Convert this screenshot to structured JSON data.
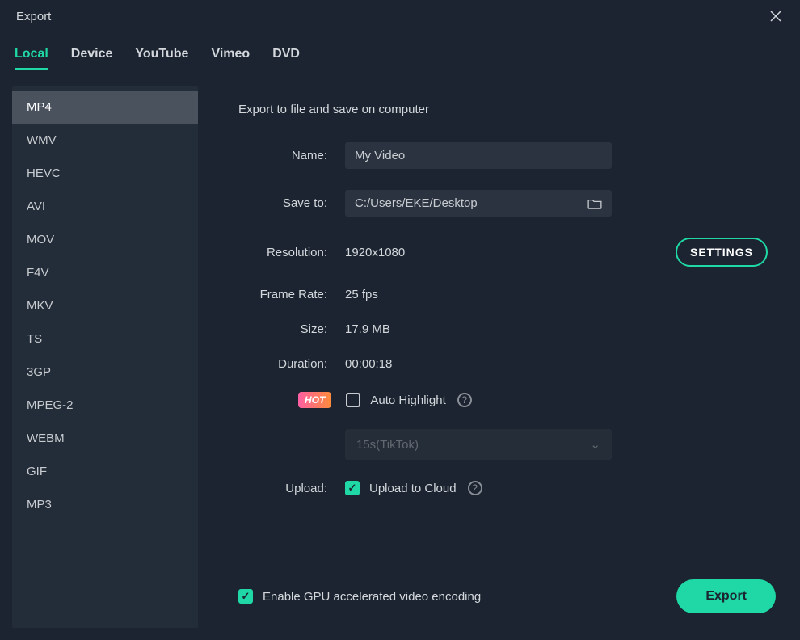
{
  "title": "Export",
  "tabs": [
    "Local",
    "Device",
    "YouTube",
    "Vimeo",
    "DVD"
  ],
  "active_tab": 0,
  "formats": [
    "MP4",
    "WMV",
    "HEVC",
    "AVI",
    "MOV",
    "F4V",
    "MKV",
    "TS",
    "3GP",
    "MPEG-2",
    "WEBM",
    "GIF",
    "MP3"
  ],
  "active_format": 0,
  "content_heading": "Export to file and save on computer",
  "labels": {
    "name": "Name:",
    "save_to": "Save to:",
    "resolution": "Resolution:",
    "frame_rate": "Frame Rate:",
    "size": "Size:",
    "duration": "Duration:",
    "upload": "Upload:"
  },
  "values": {
    "name": "My Video",
    "save_to": "C:/Users/EKE/Desktop",
    "resolution": "1920x1080",
    "frame_rate": "25 fps",
    "size": "17.9 MB",
    "duration": "00:00:18"
  },
  "settings_btn": "SETTINGS",
  "hot_badge": "HOT",
  "auto_highlight_label": "Auto Highlight",
  "auto_highlight_checked": false,
  "highlight_select": "15s(TikTok)",
  "upload_cloud_label": "Upload to Cloud",
  "upload_cloud_checked": true,
  "gpu_label": "Enable GPU accelerated video encoding",
  "gpu_checked": true,
  "export_btn": "Export"
}
